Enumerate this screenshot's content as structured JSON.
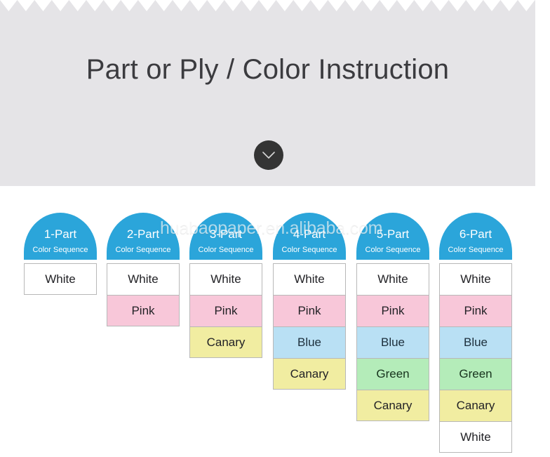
{
  "hero": {
    "title": "Part or Ply / Color Instruction",
    "scroll_button_icon": "chevron-down-icon",
    "background_color": "#e5e4e7",
    "text_color": "#3b3b3f",
    "button_color": "#343434"
  },
  "watermark": {
    "text": "huabaopaper.en.alibaba.com"
  },
  "palette": {
    "header_blue": "#2ba5da",
    "white": "#ffffff",
    "pink": "#f8c7d9",
    "canary": "#f1eda1",
    "blue": "#b9e0f4",
    "green": "#b4ecb9"
  },
  "columns": [
    {
      "title": "1-Part",
      "subtitle": "Color Sequence",
      "cells": [
        {
          "label": "White",
          "color": "#ffffff",
          "text_color": "#222226"
        }
      ]
    },
    {
      "title": "2-Part",
      "subtitle": "Color Sequence",
      "cells": [
        {
          "label": "White",
          "color": "#ffffff",
          "text_color": "#222226"
        },
        {
          "label": "Pink",
          "color": "#f8c7d9",
          "text_color": "#222226"
        }
      ]
    },
    {
      "title": "3-Part",
      "subtitle": "Color Sequence",
      "cells": [
        {
          "label": "White",
          "color": "#ffffff",
          "text_color": "#222226"
        },
        {
          "label": "Pink",
          "color": "#f8c7d9",
          "text_color": "#222226"
        },
        {
          "label": "Canary",
          "color": "#f1eda1",
          "text_color": "#222226"
        }
      ]
    },
    {
      "title": "4-Part",
      "subtitle": "Color Sequence",
      "cells": [
        {
          "label": "White",
          "color": "#ffffff",
          "text_color": "#222226"
        },
        {
          "label": "Pink",
          "color": "#f8c7d9",
          "text_color": "#222226"
        },
        {
          "label": "Blue",
          "color": "#b9e0f4",
          "text_color": "#1d2f3c"
        },
        {
          "label": "Canary",
          "color": "#f1eda1",
          "text_color": "#222226"
        }
      ]
    },
    {
      "title": "5-Part",
      "subtitle": "Color Sequence",
      "cells": [
        {
          "label": "White",
          "color": "#ffffff",
          "text_color": "#222226"
        },
        {
          "label": "Pink",
          "color": "#f8c7d9",
          "text_color": "#222226"
        },
        {
          "label": "Blue",
          "color": "#b9e0f4",
          "text_color": "#1d2f3c"
        },
        {
          "label": "Green",
          "color": "#b4ecb9",
          "text_color": "#17331d"
        },
        {
          "label": "Canary",
          "color": "#f1eda1",
          "text_color": "#222226"
        }
      ]
    },
    {
      "title": "6-Part",
      "subtitle": "Color Sequence",
      "cells": [
        {
          "label": "White",
          "color": "#ffffff",
          "text_color": "#222226"
        },
        {
          "label": "Pink",
          "color": "#f8c7d9",
          "text_color": "#222226"
        },
        {
          "label": "Blue",
          "color": "#b9e0f4",
          "text_color": "#1d2f3c"
        },
        {
          "label": "Green",
          "color": "#b4ecb9",
          "text_color": "#17331d"
        },
        {
          "label": "Canary",
          "color": "#f1eda1",
          "text_color": "#222226"
        },
        {
          "label": "White",
          "color": "#ffffff",
          "text_color": "#222226"
        }
      ]
    }
  ]
}
